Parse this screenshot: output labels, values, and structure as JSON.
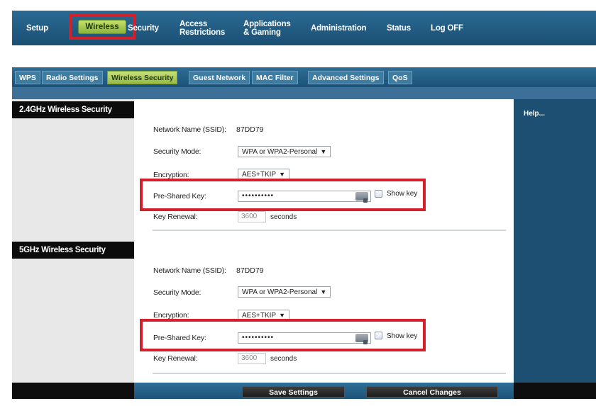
{
  "nav": {
    "setup": "Setup",
    "wireless": "Wireless",
    "security": "Security",
    "access_1": "Access",
    "access_2": "Restrictions",
    "apps_1": "Applications",
    "apps_2": "& Gaming",
    "administration": "Administration",
    "status": "Status",
    "logoff": "Log OFF"
  },
  "tabs": [
    {
      "label": "WPS"
    },
    {
      "label": "Radio Settings"
    },
    {
      "label": "Wireless Security",
      "active": true
    },
    {
      "label": "Guest Network"
    },
    {
      "label": "MAC Filter"
    },
    {
      "label": "Advanced Settings"
    },
    {
      "label": "QoS"
    }
  ],
  "sections": [
    {
      "title": "2.4GHz Wireless Security",
      "ssid_label": "Network Name (SSID):",
      "ssid_value": "87DD79",
      "security_mode_label": "Security Mode:",
      "security_mode_value": "WPA or WPA2-Personal",
      "encryption_label": "Encryption:",
      "encryption_value": "AES+TKIP",
      "psk_label": "Pre-Shared Key:",
      "psk_value": "••••••••••",
      "show_key_label": "Show key",
      "key_renewal_label": "Key Renewal:",
      "key_renewal_value": "3600",
      "seconds_label": "seconds"
    },
    {
      "title": "5GHz Wireless Security",
      "ssid_label": "Network Name (SSID):",
      "ssid_value": "87DD79",
      "security_mode_label": "Security Mode:",
      "security_mode_value": "WPA or WPA2-Personal",
      "encryption_label": "Encryption:",
      "encryption_value": "AES+TKIP",
      "psk_label": "Pre-Shared Key:",
      "psk_value": "••••••••••",
      "show_key_label": "Show key",
      "key_renewal_label": "Key Renewal:",
      "key_renewal_value": "3600",
      "seconds_label": "seconds"
    }
  ],
  "help": {
    "label": "Help..."
  },
  "actions": {
    "save": "Save Settings",
    "cancel": "Cancel Changes"
  },
  "colors": {
    "nav_blue": "#1f5b84",
    "active_green": "#a8cc4f",
    "highlight_red": "#d4202a",
    "section_black": "#0c0c0c"
  },
  "icons": {
    "dropdown": "chevron-down-icon",
    "key_generator": "key-generator-icon"
  }
}
